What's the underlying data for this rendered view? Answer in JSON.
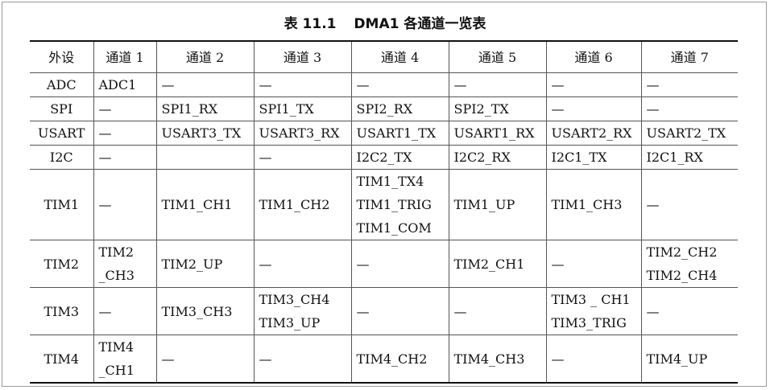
{
  "caption": {
    "number": "表 11.1",
    "title": "DMA1 各通道一览表"
  },
  "headers": [
    "外设",
    "通道 1",
    "通道 2",
    "通道 3",
    "通道 4",
    "通道 5",
    "通道 6",
    "通道 7"
  ],
  "rows": [
    {
      "name": "ADC",
      "cells": [
        [
          "ADC1"
        ],
        [
          "—"
        ],
        [
          "—"
        ],
        [
          "—"
        ],
        [
          "—"
        ],
        [
          "—"
        ],
        [
          "—"
        ]
      ]
    },
    {
      "name": "SPI",
      "cells": [
        [
          "—"
        ],
        [
          "SPI1_RX"
        ],
        [
          "SPI1_TX"
        ],
        [
          "SPI2_RX"
        ],
        [
          "SPI2_TX"
        ],
        [
          "—"
        ],
        [
          "—"
        ]
      ]
    },
    {
      "name": "USART",
      "cells": [
        [
          "—"
        ],
        [
          "USART3_TX"
        ],
        [
          "USART3_RX"
        ],
        [
          "USART1_TX"
        ],
        [
          "USART1_RX"
        ],
        [
          "USART2_RX"
        ],
        [
          "USART2_TX"
        ]
      ]
    },
    {
      "name": "I2C",
      "cells": [
        [
          "—"
        ],
        [
          ""
        ],
        [
          "—"
        ],
        [
          "I2C2_TX"
        ],
        [
          "I2C2_RX"
        ],
        [
          "I2C1_TX"
        ],
        [
          "I2C1_RX"
        ]
      ]
    },
    {
      "name": "TIM1",
      "cells": [
        [
          "—"
        ],
        [
          "TIM1_CH1"
        ],
        [
          "TIM1_CH2"
        ],
        [
          "TIM1_TX4",
          "TIM1_TRIG",
          "TIM1_COM"
        ],
        [
          "TIM1_UP"
        ],
        [
          "TIM1_CH3"
        ],
        [
          "—"
        ]
      ]
    },
    {
      "name": "TIM2",
      "cells": [
        [
          "TIM2",
          "_CH3"
        ],
        [
          "TIM2_UP"
        ],
        [
          "—"
        ],
        [
          "—"
        ],
        [
          "TIM2_CH1"
        ],
        [
          "—"
        ],
        [
          "TIM2_CH2",
          "TIM2_CH4"
        ]
      ]
    },
    {
      "name": "TIM3",
      "cells": [
        [
          "—"
        ],
        [
          "TIM3_CH3"
        ],
        [
          "TIM3_CH4",
          "TIM3_UP"
        ],
        [
          "—"
        ],
        [
          "—"
        ],
        [
          "TIM3 _ CH1",
          "TIM3_TRIG"
        ],
        [
          "—"
        ]
      ]
    },
    {
      "name": "TIM4",
      "cells": [
        [
          "TIM4",
          "_CH1"
        ],
        [
          "—"
        ],
        [
          "—"
        ],
        [
          "TIM4_CH2"
        ],
        [
          "TIM4_CH3"
        ],
        [
          "—"
        ],
        [
          "TIM4_UP"
        ]
      ]
    }
  ]
}
